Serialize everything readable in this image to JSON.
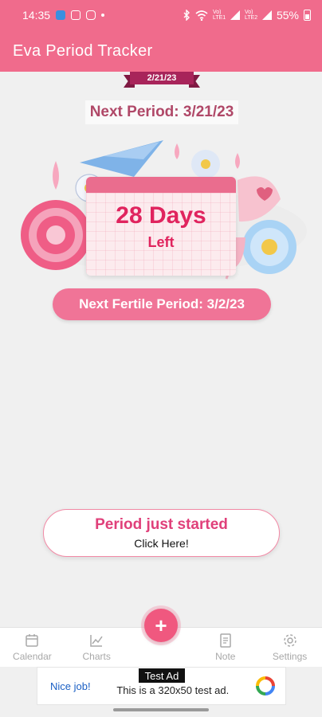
{
  "status_bar": {
    "time": "14:35",
    "signal_1": "Vo) LTE1",
    "signal_2": "Vo) LTE2",
    "battery": "55%"
  },
  "app": {
    "title": "Eva Period Tracker"
  },
  "date_ribbon": "2/21/23",
  "next_period": "Next Period: 3/21/23",
  "countdown": {
    "days": "28 Days",
    "suffix": "Left"
  },
  "next_fertile": "Next Fertile Period: 3/2/23",
  "period_button": {
    "title": "Period just started",
    "subtitle": "Click Here!"
  },
  "fab_label": "+",
  "bottom_nav": [
    {
      "label": "Calendar",
      "icon": "calendar-icon"
    },
    {
      "label": "Charts",
      "icon": "chart-icon"
    },
    {
      "label": "Note",
      "icon": "note-icon"
    },
    {
      "label": "Settings",
      "icon": "gear-icon"
    }
  ],
  "ad": {
    "label": "Test Ad",
    "nice_job": "Nice job!",
    "text": "This is a 320x50 test ad."
  },
  "colors": {
    "primary": "#f06b8c",
    "ribbon": "#a8245a",
    "accent_text": "#e0245e",
    "fertile_pill": "#f07497"
  }
}
